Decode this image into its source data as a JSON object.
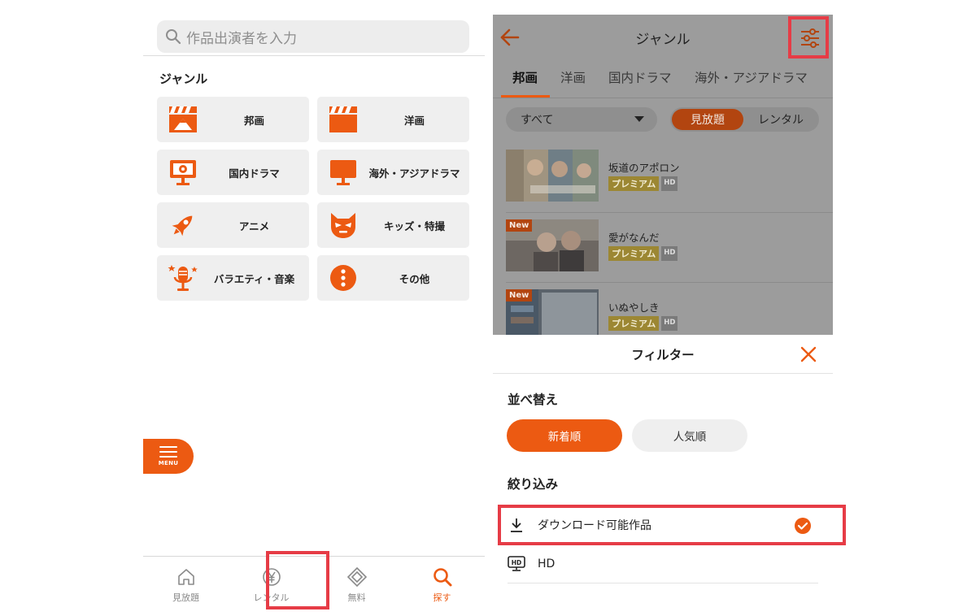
{
  "search": {
    "placeholder": "作品出演者を入力"
  },
  "genre": {
    "heading": "ジャンル",
    "items": [
      {
        "label": "邦画",
        "icon": "clapperboard-mountain-icon"
      },
      {
        "label": "洋画",
        "icon": "clapperboard-icon"
      },
      {
        "label": "国内ドラマ",
        "icon": "tv-flower-icon"
      },
      {
        "label": "海外・アジアドラマ",
        "icon": "tv-icon"
      },
      {
        "label": "アニメ",
        "icon": "rocket-icon"
      },
      {
        "label": "キッズ・特撮",
        "icon": "hero-mask-icon"
      },
      {
        "label": "バラエティ・音楽",
        "icon": "microphone-icon"
      },
      {
        "label": "その他",
        "icon": "more-dots-icon"
      }
    ]
  },
  "menu_button": {
    "label": "MENU"
  },
  "bottom_nav": [
    {
      "label": "見放題",
      "icon": "home-icon",
      "active": false
    },
    {
      "label": "レンタル",
      "icon": "yen-icon",
      "active": false
    },
    {
      "label": "無料",
      "icon": "diamond-icon",
      "active": false
    },
    {
      "label": "探す",
      "icon": "search-icon",
      "active": true
    }
  ],
  "genre_page": {
    "title": "ジャンル",
    "tabs": [
      "邦画",
      "洋画",
      "国内ドラマ",
      "海外・アジアドラマ"
    ],
    "active_tab": "邦画",
    "dropdown": {
      "value": "すべて"
    },
    "segment": {
      "selected": "見放題",
      "other": "レンタル"
    },
    "titles": [
      {
        "name": "坂道のアポロン",
        "new": false,
        "badges": [
          "プレミアム",
          "HD"
        ]
      },
      {
        "name": "愛がなんだ",
        "new": true,
        "new_label": "New",
        "badges": [
          "プレミアム",
          "HD"
        ]
      },
      {
        "name": "いぬやしき",
        "new": true,
        "new_label": "New",
        "badges": [
          "プレミアム",
          "HD"
        ]
      }
    ]
  },
  "filter_sheet": {
    "title": "フィルター",
    "sort_heading": "並べ替え",
    "sort_options": [
      "新着順",
      "人気順"
    ],
    "sort_selected": "新着順",
    "refine_heading": "絞り込み",
    "refine_options": [
      {
        "label": "ダウンロード可能作品",
        "icon": "download-icon",
        "checked": true
      },
      {
        "label": "HD",
        "icon": "hd-icon",
        "checked": false
      }
    ]
  },
  "colors": {
    "accent": "#ec5a12",
    "highlight": "#e63c46",
    "tile": "#efefef",
    "premium": "#9c8733"
  }
}
